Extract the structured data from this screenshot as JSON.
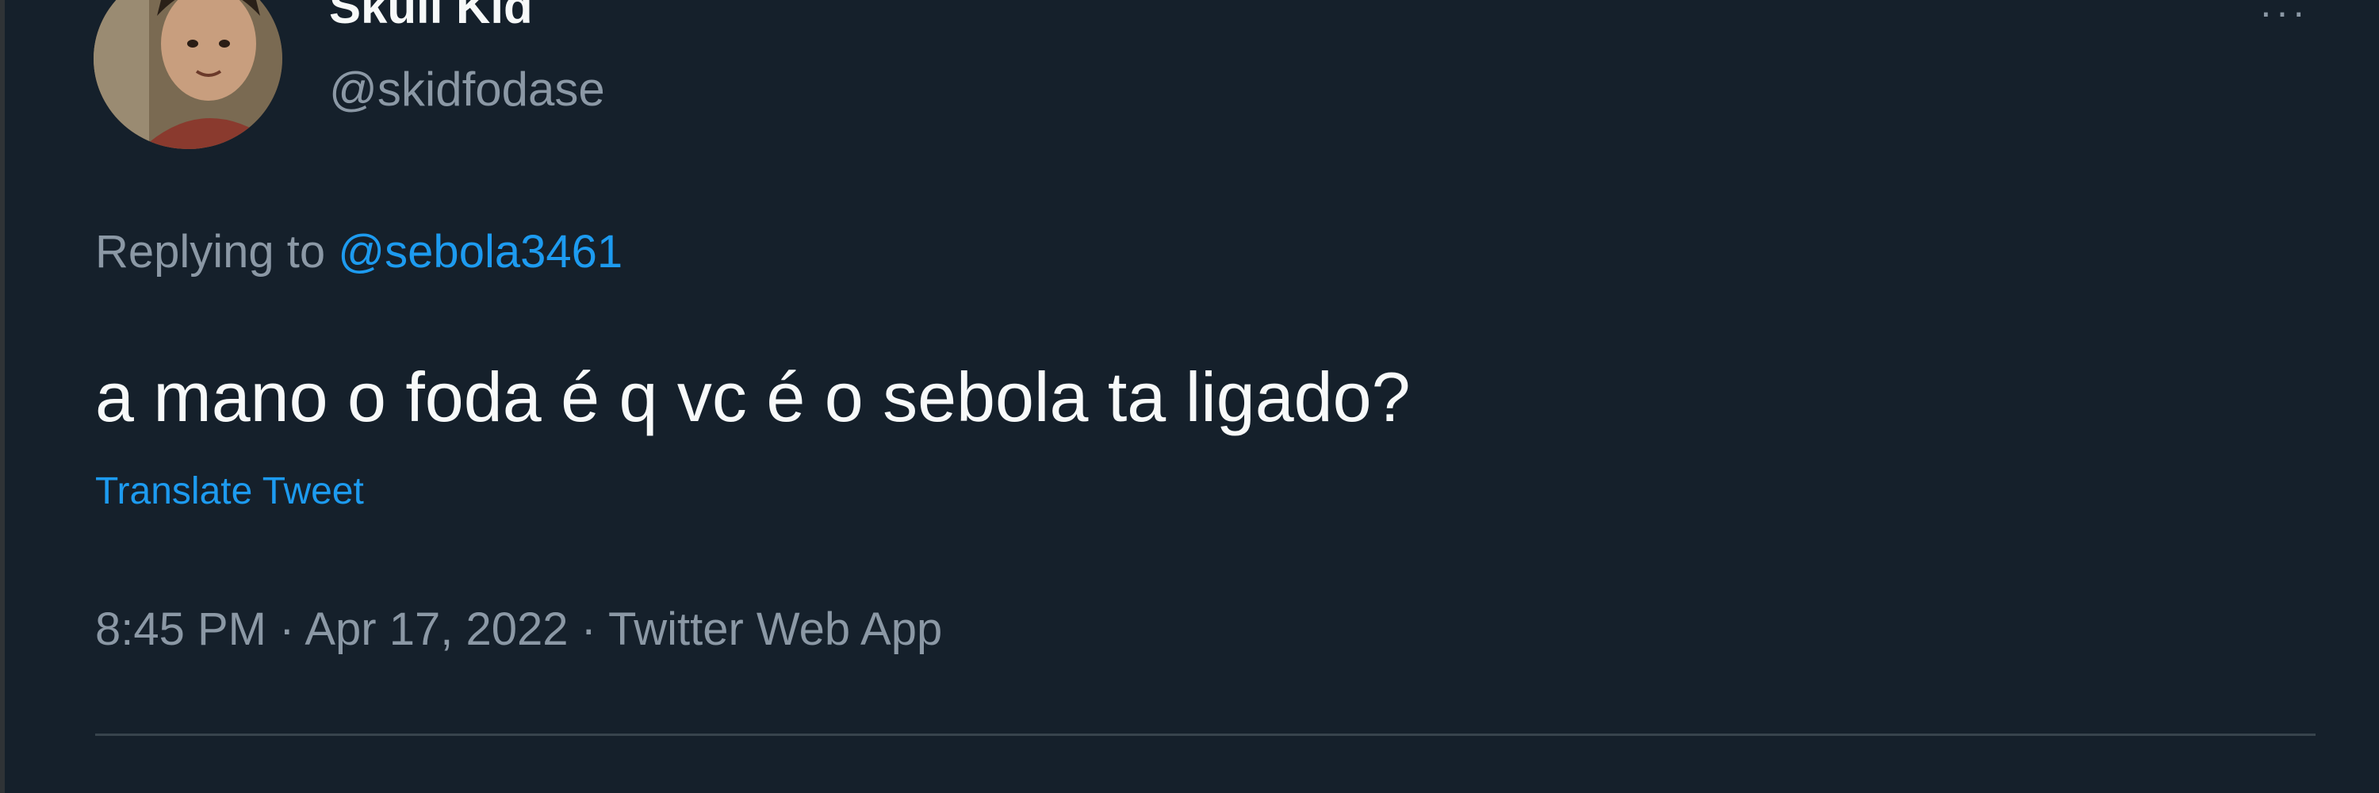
{
  "tweet": {
    "display_name": "Skull Kid",
    "handle": "@skidfodase",
    "replying_prefix": "Replying to ",
    "replying_to": "@sebola3461",
    "text": "a mano o foda é q vc é o sebola ta ligado?",
    "translate_label": "Translate Tweet",
    "time": "8:45 PM",
    "separator": " · ",
    "date": "Apr 17, 2022",
    "source": "Twitter Web App",
    "more_icon": "more-horizontal-icon"
  },
  "colors": {
    "background": "#15202b",
    "text_primary": "#f7f9f9",
    "text_secondary": "#8b98a5",
    "accent": "#1d9bf0",
    "divider": "#38444d"
  }
}
